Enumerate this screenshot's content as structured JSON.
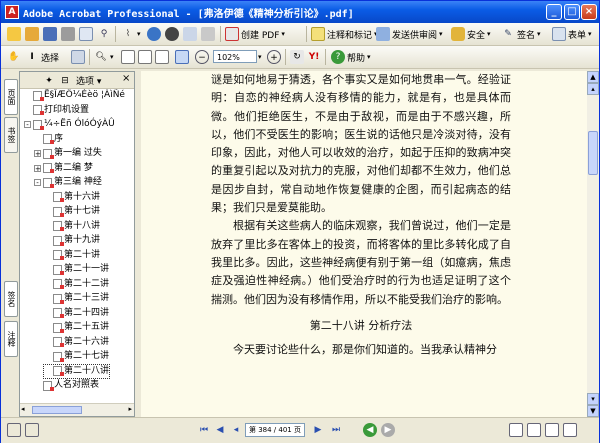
{
  "window": {
    "title": "Adobe Acrobat Professional - [弗洛伊德《精神分析引论》.pdf]"
  },
  "toolbar1": {
    "create_pdf": "创建 PDF",
    "comment": "注释和标记",
    "send_review": "发送供审阅",
    "secure": "安全",
    "sign": "签名",
    "forms": "表单"
  },
  "toolbar2": {
    "select_text": "选择",
    "zoom_value": "102%",
    "help": "帮助"
  },
  "lefttabs": {
    "bookmarks": "书签",
    "signatures": "签名",
    "pages": "页面",
    "comments": "注释"
  },
  "navpanel": {
    "options": "选项",
    "items": [
      {
        "label": "Ë§ÎÆÖ¼Éèö  ¦ÀìÑé",
        "level": 0,
        "expand": ""
      },
      {
        "label": "打印机设置",
        "level": 0,
        "expand": ""
      },
      {
        "label": "¼÷Ëñ ÓlóÓýÀÛ",
        "level": 0,
        "expand": "-"
      },
      {
        "label": "序",
        "level": 1,
        "expand": ""
      },
      {
        "label": "第一编  过失",
        "level": 1,
        "expand": "+"
      },
      {
        "label": "第二编  梦",
        "level": 1,
        "expand": "+"
      },
      {
        "label": "第三编  神经",
        "level": 1,
        "expand": "-"
      },
      {
        "label": "第十六讲",
        "level": 2,
        "expand": ""
      },
      {
        "label": "第十七讲",
        "level": 2,
        "expand": ""
      },
      {
        "label": "第十八讲",
        "level": 2,
        "expand": ""
      },
      {
        "label": "第十九讲",
        "level": 2,
        "expand": ""
      },
      {
        "label": "第二十讲",
        "level": 2,
        "expand": ""
      },
      {
        "label": "第二十一讲",
        "level": 2,
        "expand": ""
      },
      {
        "label": "第二十二讲",
        "level": 2,
        "expand": ""
      },
      {
        "label": "第二十三讲",
        "level": 2,
        "expand": ""
      },
      {
        "label": "第二十四讲",
        "level": 2,
        "expand": ""
      },
      {
        "label": "第二十五讲",
        "level": 2,
        "expand": ""
      },
      {
        "label": "第二十六讲",
        "level": 2,
        "expand": ""
      },
      {
        "label": "第二十七讲",
        "level": 2,
        "expand": ""
      },
      {
        "label": "第二十八讲",
        "level": 2,
        "expand": "",
        "selected": true
      },
      {
        "label": "人名对照表",
        "level": 1,
        "expand": ""
      }
    ]
  },
  "document": {
    "p1": "谜是如何地易于猜透，各个事实又是如何地贯串一气。经验证明：自恋的神经病人没有移情的能力，就是有，也是具体而微。他们拒绝医生，不是由于敌视，而是由于不感兴趣，所以，他们不受医生的影响；医生说的话他只是冷淡对待，没有印象，因此，对他人可以收效的治疗，如起于压抑的致病冲突的重复引起以及对抗力的克服，对他们却都不生效力，他们总是因步自封，常自动地作恢复健康的企图，而引起病态的结果；我们只是爱莫能助。",
    "p2": "根据有关这些病人的临床观察，我们曾说过，他们一定是放弃了里比多在客体上的投资，而将客体的里比多转化成了自我里比多。因此，这些神经病便有别于第一组（如癔病，焦虑症及强迫性神经病。）他们受治疗时的行为也适足证明了这个揣测。他们因为没有移情作用，所以不能受我们治疗的影响。",
    "heading": "第二十八讲    分析疗法",
    "p3": "今天要讨论些什么，那是你们知道的。当我承认精神分"
  },
  "statusbar": {
    "page_indicator": "第 384 / 401 页"
  }
}
